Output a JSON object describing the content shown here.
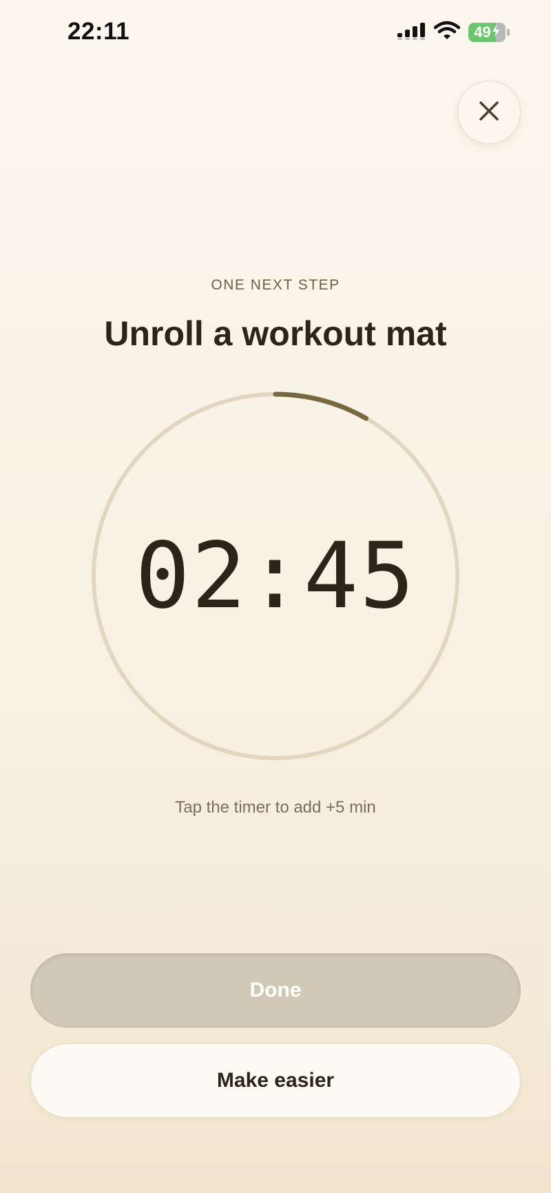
{
  "status_bar": {
    "time": "22:11",
    "battery_level": "49",
    "icons": [
      "cellular-signal-icon",
      "wifi-icon",
      "battery-icon",
      "charging-bolt-icon"
    ]
  },
  "close_icon": "close-icon",
  "step": {
    "eyebrow": "ONE NEXT STEP",
    "title": "Unroll a workout mat"
  },
  "timer": {
    "display": "02:45",
    "progress_fraction": 0.083,
    "track_color": "#e2d6c0",
    "progress_color": "#776840"
  },
  "hint": "Tap the timer to add +5 min",
  "buttons": {
    "done_label": "Done",
    "make_easier_label": "Make easier"
  },
  "colors": {
    "background_top": "#fbf7ee",
    "background_bottom": "#f3e6cf",
    "done_button": "#d1c8b6",
    "text_primary": "#2b2418"
  }
}
